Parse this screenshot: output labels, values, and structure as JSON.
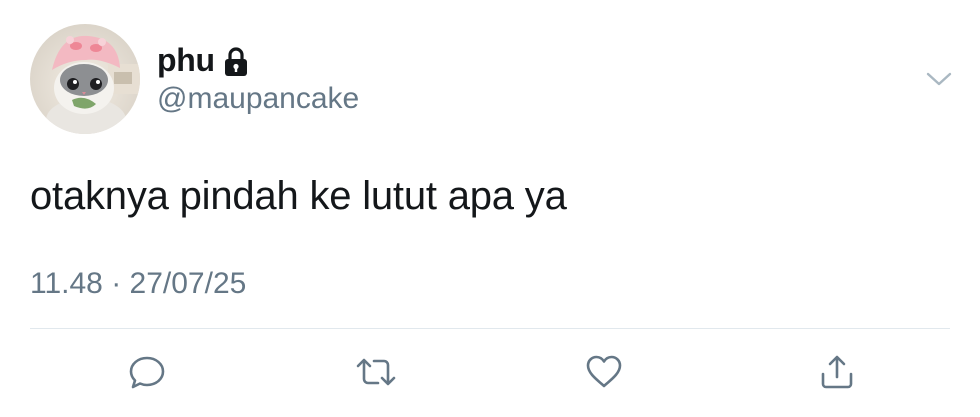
{
  "user": {
    "display_name": "phu",
    "handle": "@maupancake",
    "protected": true,
    "avatar_description_icon": "cat-with-pink-hat-avatar"
  },
  "tweet": {
    "text": "otaknya pindah ke lutut apa ya",
    "time": "11.48",
    "separator": "·",
    "date": "27/07/25"
  },
  "actions": {
    "reply_icon": "reply-icon",
    "retweet_icon": "retweet-icon",
    "like_icon": "heart-icon",
    "share_icon": "share-icon"
  },
  "colors": {
    "primary_text": "#14171a",
    "secondary_text": "#657786",
    "divider": "#e1e8ed",
    "icon": "#657786"
  }
}
